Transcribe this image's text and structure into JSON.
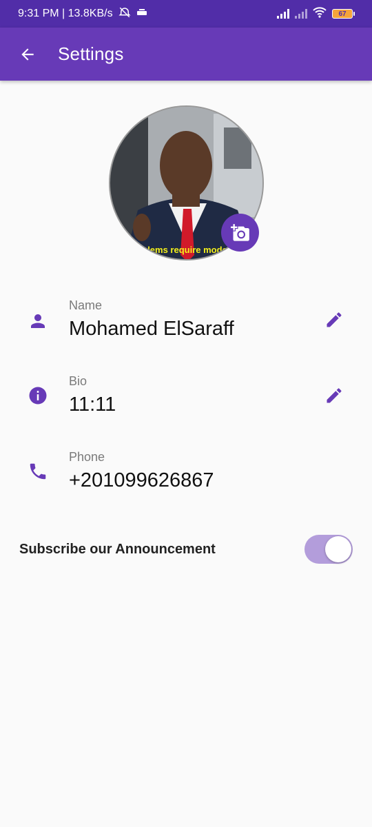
{
  "status_bar": {
    "time_speed": "9:31 PM | 13.8KB/s",
    "battery_level": "67"
  },
  "app_bar": {
    "title": "Settings"
  },
  "avatar": {
    "caption": "lems require mode"
  },
  "fields": [
    {
      "label": "Name",
      "value": "Mohamed ElSaraff",
      "icon": "person-icon",
      "editable": true
    },
    {
      "label": "Bio",
      "value": "11:11",
      "icon": "info-icon",
      "editable": true
    },
    {
      "label": "Phone",
      "value": "+201099626867",
      "icon": "phone-icon",
      "editable": false
    }
  ],
  "subscribe": {
    "label": "Subscribe our Announcement",
    "enabled": true
  },
  "colors": {
    "primary": "#673ab7",
    "primary_dark": "#512da8",
    "switch_track": "#b39ddb"
  }
}
